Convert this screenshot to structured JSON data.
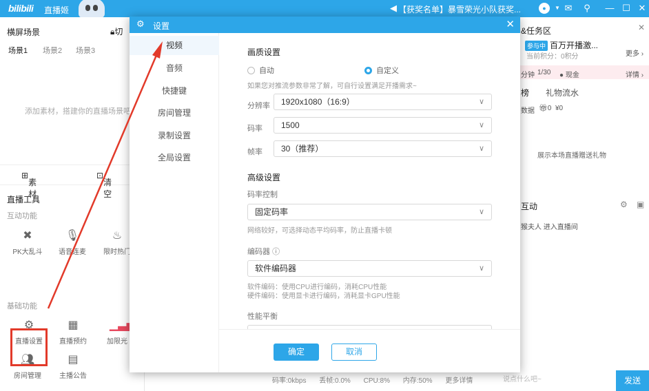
{
  "titlebar": {
    "logo": "bilibili",
    "app_name": "直播姬",
    "notice": "【获奖名单】暴雪荣光小队获奖...",
    "icons": [
      "megaphone-icon",
      "avatar",
      "mail-icon",
      "pin-icon",
      "minimize-icon",
      "maximize-icon",
      "close-icon"
    ]
  },
  "left": {
    "title": "横屏场景",
    "switch_label": "切",
    "scenes": [
      "场景1",
      "场景2",
      "场景3"
    ],
    "empty_hint": "添加素材，搭建你的直播场景吧！",
    "material_label": "素材",
    "clear_label": "清空",
    "tools_title": "直播工具",
    "interactive_title": "互动功能",
    "interactive_tools": [
      "PK大乱斗",
      "语音连麦",
      "限时热门"
    ],
    "basic_title": "基础功能",
    "basic_tools": [
      "直播设置",
      "直播预约",
      "加限光"
    ],
    "basic_tools2": [
      "房间管理",
      "主播公告"
    ]
  },
  "right": {
    "task_title": "&任务区",
    "badge": "参与中",
    "task_name": "百万开播激...",
    "points": "当前积分：0积分",
    "more": "更多",
    "progress_a": "分钟",
    "progress_b": "1/30",
    "cash": "现金",
    "detail": "详情",
    "gift_tab_a": "榜",
    "gift_tab_b": "礼物流水",
    "stats_label": "数据",
    "stats_a": "0",
    "stats_b": "¥0",
    "gift_hint": "展示本场直播赠送礼物",
    "interact_title": "互动",
    "enter_msg": "猴夫人 进入直播间",
    "chat_placeholder": "说点什么吧~",
    "send": "发送"
  },
  "status": {
    "bitrate": "码率:0kbps",
    "drop": "丢帧:0.0%",
    "cpu": "CPU:8%",
    "mem": "内存:50%",
    "more": "更多详情"
  },
  "dialog": {
    "title": "设置",
    "nav": [
      "视频",
      "音频",
      "快捷键",
      "房间管理",
      "录制设置",
      "全局设置"
    ],
    "quality_title": "画质设置",
    "radio_auto": "自动",
    "radio_custom": "自定义",
    "quality_hint": "如果您对推流参数非常了解，可自行设置满足开播需求~",
    "resolution_label": "分辨率",
    "resolution_value": "1920x1080（16:9）",
    "bitrate_label": "码率",
    "bitrate_value": "1500",
    "framerate_label": "帧率",
    "framerate_value": "30（推荐）",
    "advanced_title": "高级设置",
    "rate_control_label": "码率控制",
    "rate_control_value": "固定码率",
    "rate_control_hint": "网络较好，可选择动态平均码率，防止直播卡顿",
    "encoder_label": "编码器",
    "encoder_value": "软件编码器",
    "encoder_hint1": "软件编码：使用CPU进行编码，消耗CPU性能",
    "encoder_hint2": "硬件编码：使用显卡进行编码，消耗显卡GPU性能",
    "perf_label": "性能平衡",
    "ok": "确定",
    "cancel": "取消"
  },
  "colors": {
    "accent": "#2da6e8",
    "annotation": "#e23a2a"
  }
}
